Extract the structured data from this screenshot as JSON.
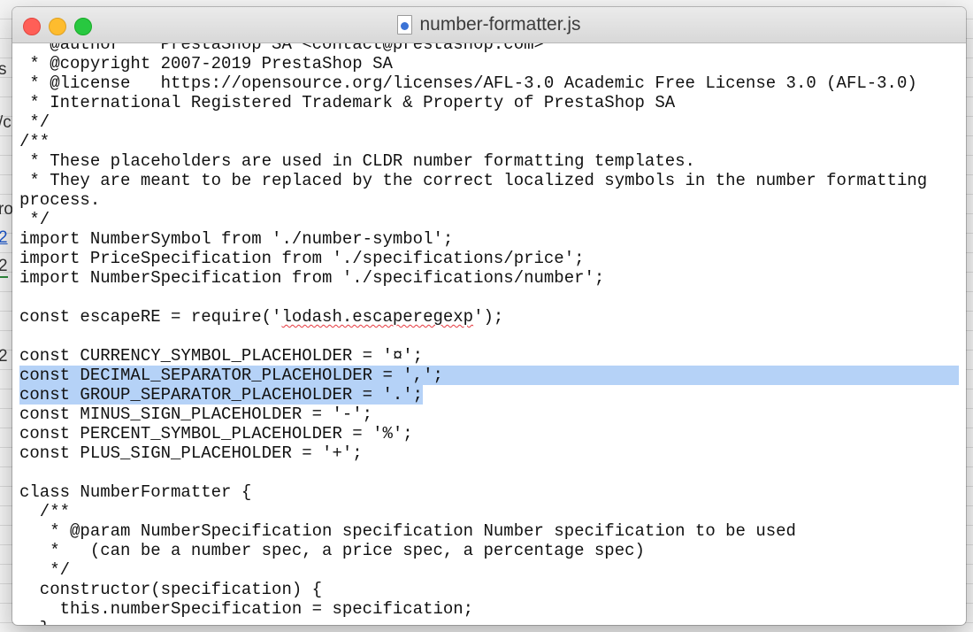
{
  "window": {
    "title": "number-formatter.js",
    "file_icon": "js-file-icon"
  },
  "background": {
    "left_fragments": [
      "s",
      "/c",
      "ro",
      "2",
      "2",
      "2"
    ]
  },
  "editor": {
    "lines": [
      " * @author    PrestaShop SA <contact@prestashop.com>",
      " * @copyright 2007-2019 PrestaShop SA",
      " * @license   https://opensource.org/licenses/AFL-3.0 Academic Free License 3.0 (AFL-3.0)",
      " * International Registered Trademark & Property of PrestaShop SA",
      " */",
      "/**",
      " * These placeholders are used in CLDR number formatting templates.",
      " * They are meant to be replaced by the correct localized symbols in the number formatting",
      "process.",
      " */",
      "import NumberSymbol from './number-symbol';",
      "import PriceSpecification from './specifications/price';",
      "import NumberSpecification from './specifications/number';",
      "",
      "const escapeRE = require('lodash.escaperegexp');",
      "",
      "const CURRENCY_SYMBOL_PLACEHOLDER = '¤';",
      "const DECIMAL_SEPARATOR_PLACEHOLDER = ',';",
      "const GROUP_SEPARATOR_PLACEHOLDER = '.';",
      "const MINUS_SIGN_PLACEHOLDER = '-';",
      "const PERCENT_SYMBOL_PLACEHOLDER = '%';",
      "const PLUS_SIGN_PLACEHOLDER = '+';",
      "",
      "class NumberFormatter {",
      "  /**",
      "   * @param NumberSpecification specification Number specification to be used",
      "   *   (can be a number spec, a price spec, a percentage spec)",
      "   */",
      "  constructor(specification) {",
      "    this.numberSpecification = specification;",
      "  }"
    ],
    "highlighted_lines": [
      17,
      18
    ],
    "spellcheck": {
      "line": 14,
      "before": "const escapeRE = require('",
      "word": "lodash.escaperegexp",
      "after": "');"
    }
  }
}
